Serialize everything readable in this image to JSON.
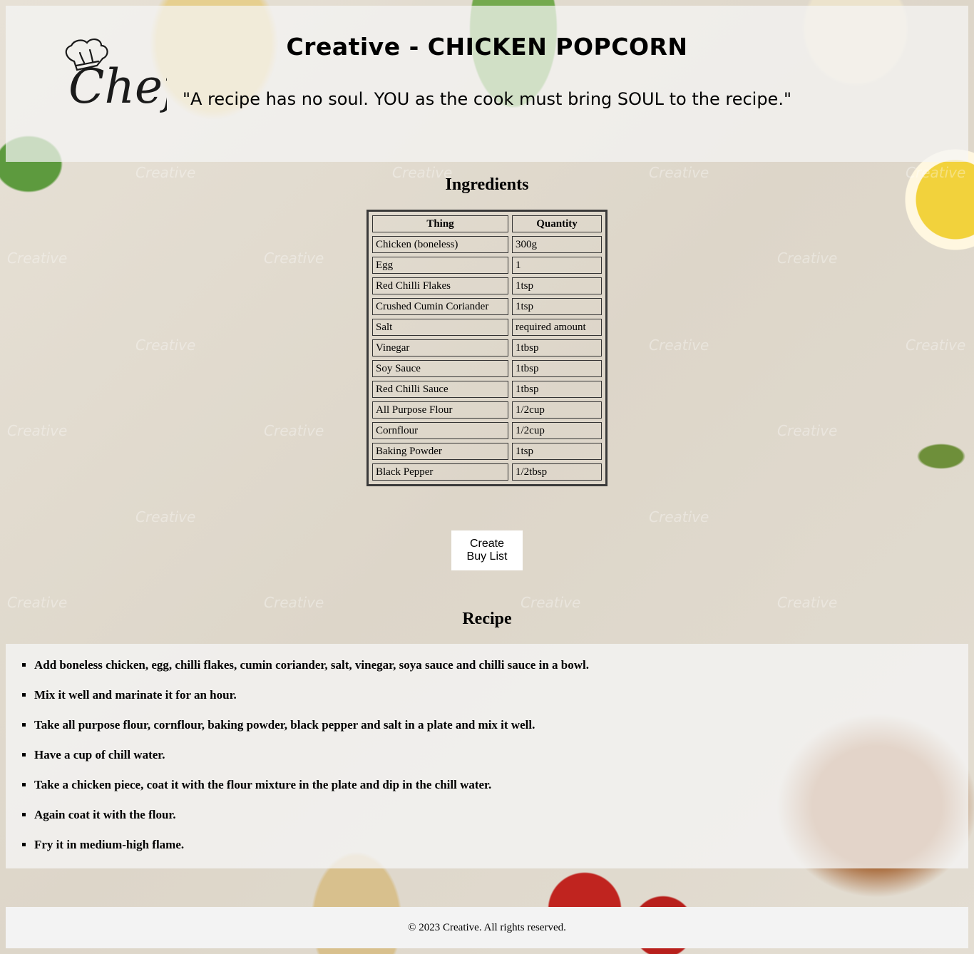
{
  "header": {
    "logo_text": "Chef",
    "title": "Creative - CHICKEN POPCORN",
    "quote": "\"A recipe has no soul. YOU as the cook must bring SOUL to the recipe.\""
  },
  "ingredients": {
    "heading": "Ingredients",
    "columns": [
      "Thing",
      "Quantity"
    ],
    "rows": [
      {
        "thing": "Chicken (boneless)",
        "qty": "300g"
      },
      {
        "thing": "Egg",
        "qty": "1"
      },
      {
        "thing": "Red Chilli Flakes",
        "qty": "1tsp"
      },
      {
        "thing": "Crushed Cumin Coriander",
        "qty": "1tsp"
      },
      {
        "thing": "Salt",
        "qty": "required amount"
      },
      {
        "thing": "Vinegar",
        "qty": "1tbsp"
      },
      {
        "thing": "Soy Sauce",
        "qty": "1tbsp"
      },
      {
        "thing": "Red Chilli Sauce",
        "qty": "1tbsp"
      },
      {
        "thing": "All Purpose Flour",
        "qty": "1/2cup"
      },
      {
        "thing": "Cornflour",
        "qty": "1/2cup"
      },
      {
        "thing": "Baking Powder",
        "qty": "1tsp"
      },
      {
        "thing": "Black Pepper",
        "qty": "1/2tbsp"
      }
    ],
    "button_label": "Create Buy List"
  },
  "recipe": {
    "heading": "Recipe",
    "steps": [
      "Add boneless chicken, egg, chilli flakes, cumin coriander, salt, vinegar, soya sauce and chilli sauce in a bowl.",
      "Mix it well and marinate it for an hour.",
      "Take all purpose flour, cornflour, baking powder, black pepper and salt in a plate and mix it well.",
      "Have a cup of chill water.",
      "Take a chicken piece, coat it with the flour mixture in the plate and dip in the chill water.",
      "Again coat it with the flour.",
      "Fry it in medium-high flame."
    ]
  },
  "footer": {
    "text": "© 2023 Creative. All rights reserved."
  },
  "background_watermark": "Creative"
}
